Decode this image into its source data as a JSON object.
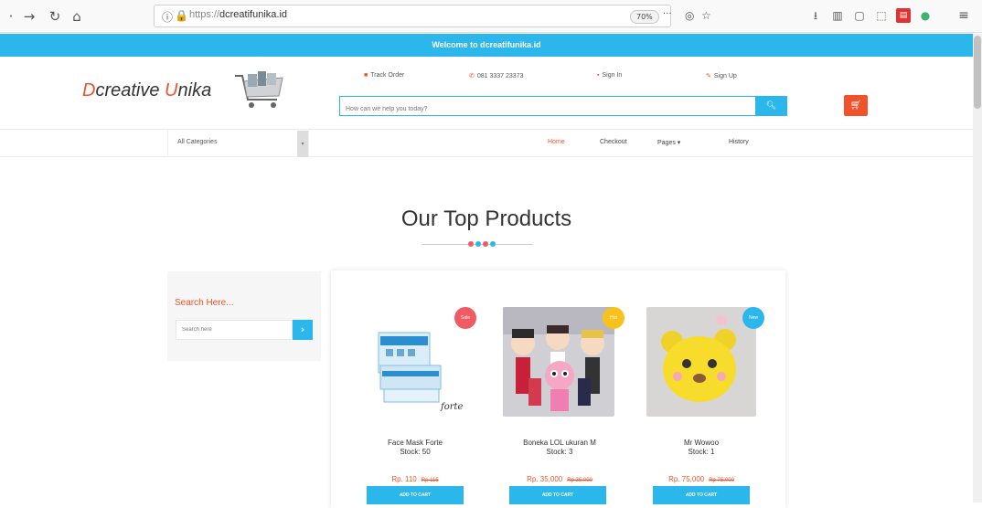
{
  "browser": {
    "url_proto": "https://",
    "url_host": "dcreatifunika.id",
    "zoom": "70%",
    "more_icon": "···"
  },
  "welcome_text": "Welcome to dcreatifunika.id",
  "logo": {
    "cap1": "D",
    "rest1": "creative ",
    "cap2": "U",
    "rest2": "nika"
  },
  "top_links": {
    "track_order": "Track Order",
    "phone": "081 3337 23373",
    "sign_in": "Sign In",
    "sign_up": "Sign Up"
  },
  "search": {
    "placeholder": "How can we help you today?"
  },
  "categories": {
    "selected": "All Categories"
  },
  "nav": {
    "home": "Home",
    "checkout": "Checkout",
    "pages": "Pages ▾",
    "history": "History"
  },
  "section_title": "Our Top Products",
  "sidebar": {
    "title": "Search Here...",
    "placeholder": "Search here"
  },
  "products": [
    {
      "name": "Face Mask Forte",
      "stock": "Stock: 50",
      "price": "Rp. 110",
      "old_price": "Rp 115",
      "badge": "Sale",
      "badge_color": "#ef5a63",
      "cta": "ADD TO CART"
    },
    {
      "name": "Boneka LOL ukuran M",
      "stock": "Stock: 3",
      "price": "Rp. 35,000",
      "old_price": "Rp 35,000",
      "badge": "Hot",
      "badge_color": "#f7c21a",
      "cta": "ADD TO CART"
    },
    {
      "name": "Mr Wowoo",
      "stock": "Stock: 1",
      "price": "Rp. 75,000",
      "old_price": "Rp 75,000",
      "badge": "New",
      "badge_color": "#2bb6ec",
      "cta": "ADD TO CART"
    }
  ],
  "colors": {
    "accent": "#2bb6ec",
    "brand": "#f0532b"
  }
}
